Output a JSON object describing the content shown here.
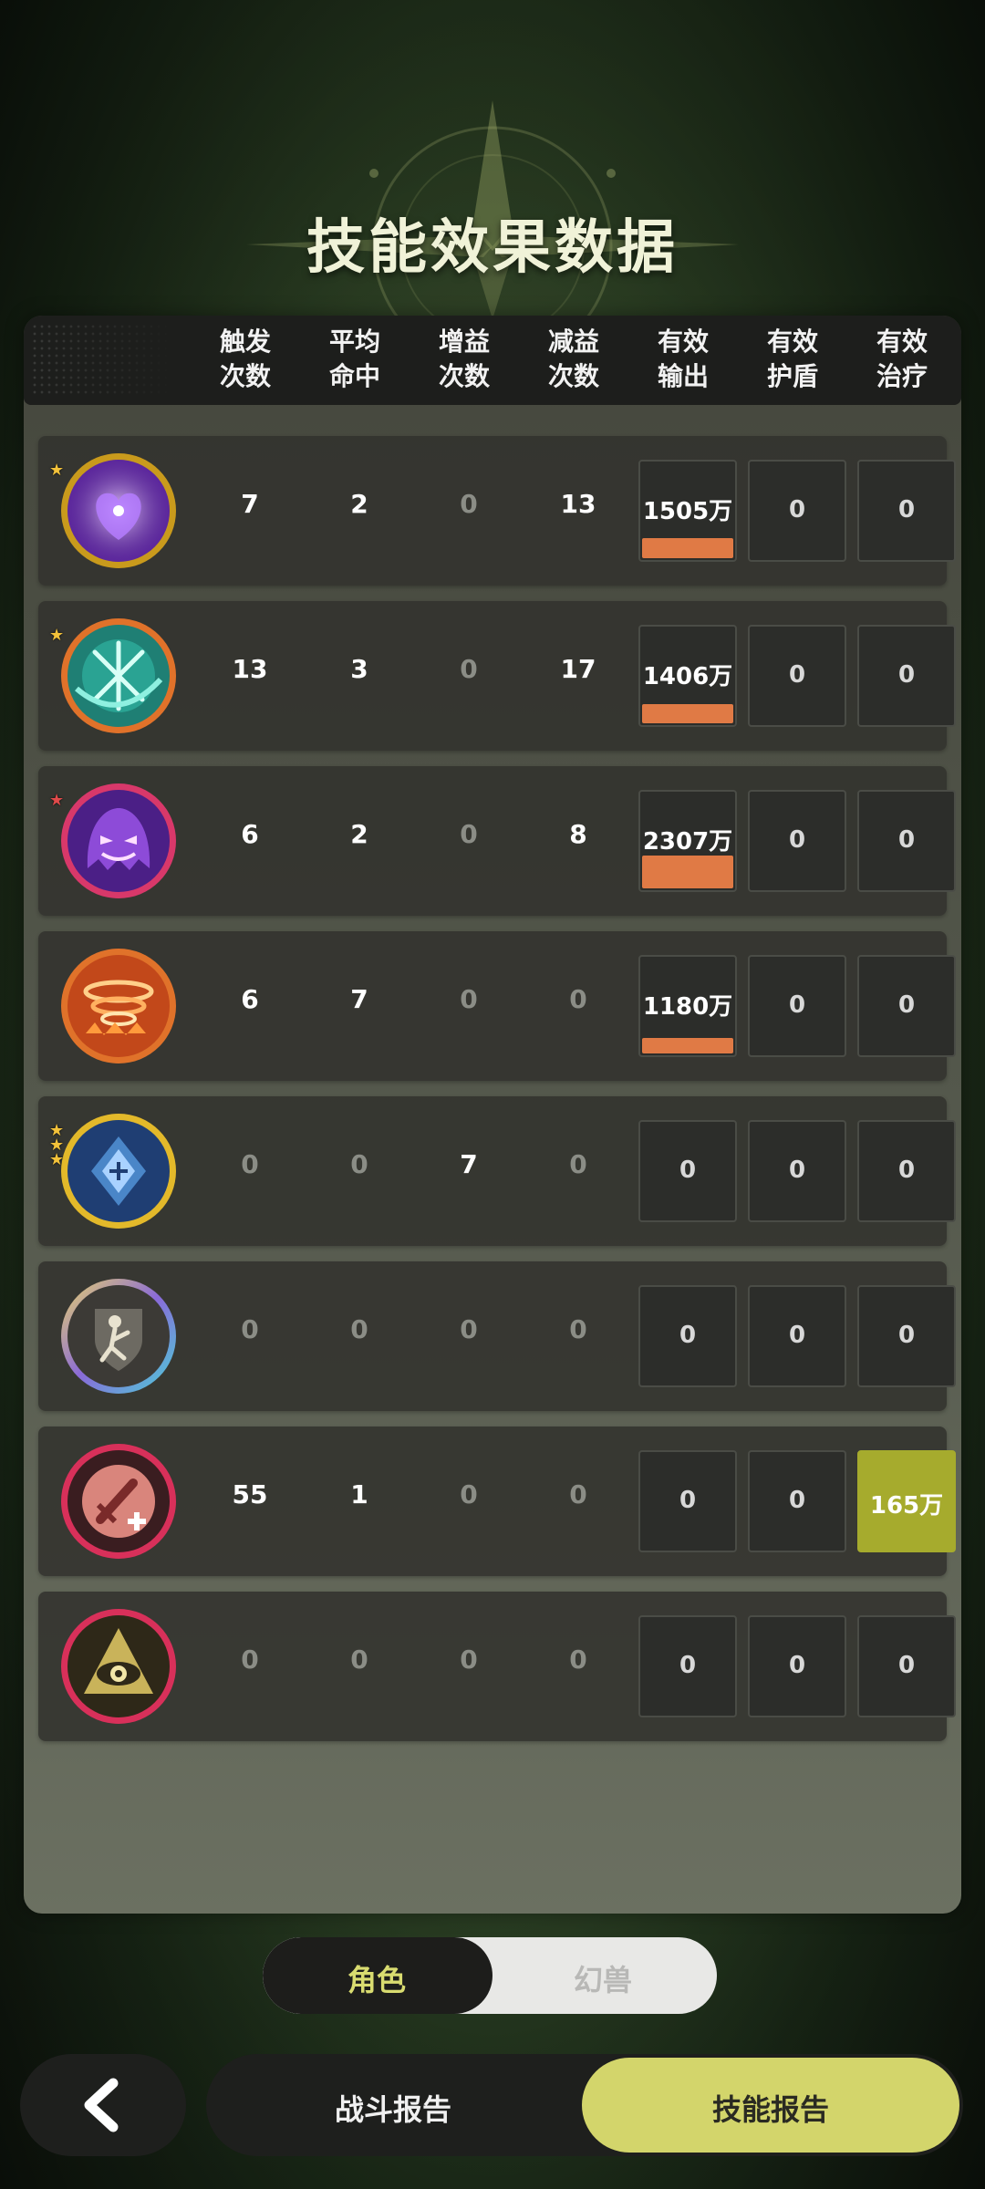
{
  "title": "技能效果数据",
  "columns": [
    {
      "line1": "触发",
      "line2": "次数"
    },
    {
      "line1": "平均",
      "line2": "命中"
    },
    {
      "line1": "增益",
      "line2": "次数"
    },
    {
      "line1": "减益",
      "line2": "次数"
    },
    {
      "line1": "有效",
      "line2": "输出"
    },
    {
      "line1": "有效",
      "line2": "护盾"
    },
    {
      "line1": "有效",
      "line2": "治疗"
    }
  ],
  "rows": [
    {
      "icon": "purple-heart-skill-icon",
      "stars": 1,
      "trigger": "7",
      "hits": "2",
      "buff": "0",
      "debuff": "13",
      "output": "1505万",
      "output_ratio": 0.2,
      "shield": "0",
      "heal": "0"
    },
    {
      "icon": "teal-slash-skill-icon",
      "stars": 1,
      "trigger": "13",
      "hits": "3",
      "buff": "0",
      "debuff": "17",
      "output": "1406万",
      "output_ratio": 0.19,
      "shield": "0",
      "heal": "0"
    },
    {
      "icon": "ghost-skill-icon",
      "stars": 1,
      "trigger": "6",
      "hits": "2",
      "buff": "0",
      "debuff": "8",
      "output": "2307万",
      "output_ratio": 0.33,
      "shield": "0",
      "heal": "0"
    },
    {
      "icon": "fire-vortex-skill-icon",
      "stars": 0,
      "trigger": "6",
      "hits": "7",
      "buff": "0",
      "debuff": "0",
      "output": "1180万",
      "output_ratio": 0.16,
      "shield": "0",
      "heal": "0"
    },
    {
      "icon": "blue-crest-skill-icon",
      "stars": 3,
      "trigger": "0",
      "hits": "0",
      "buff": "7",
      "debuff": "0",
      "output": "0",
      "output_ratio": 0,
      "shield": "0",
      "heal": "0"
    },
    {
      "icon": "dancer-shield-skill-icon",
      "stars": 0,
      "trigger": "0",
      "hits": "0",
      "buff": "0",
      "debuff": "0",
      "output": "0",
      "output_ratio": 0,
      "shield": "0",
      "heal": "0"
    },
    {
      "icon": "sword-heal-skill-icon",
      "stars": 0,
      "trigger": "55",
      "hits": "1",
      "buff": "0",
      "debuff": "0",
      "output": "0",
      "output_ratio": 0,
      "shield": "0",
      "heal": "165万"
    },
    {
      "icon": "eye-skill-icon",
      "stars": 0,
      "trigger": "0",
      "hits": "0",
      "buff": "0",
      "debuff": "0",
      "output": "0",
      "output_ratio": 0,
      "shield": "0",
      "heal": "0"
    }
  ],
  "toggle": {
    "active": "角色",
    "inactive": "幻兽"
  },
  "tabs": {
    "battle_report": "战斗报告",
    "skill_report": "技能报告"
  },
  "colors": {
    "output_bar": "#e07a45",
    "heal_fill": "#a6ab2d",
    "active_tab": "#d3d56b",
    "toggle_active_text": "#d9dc70"
  }
}
